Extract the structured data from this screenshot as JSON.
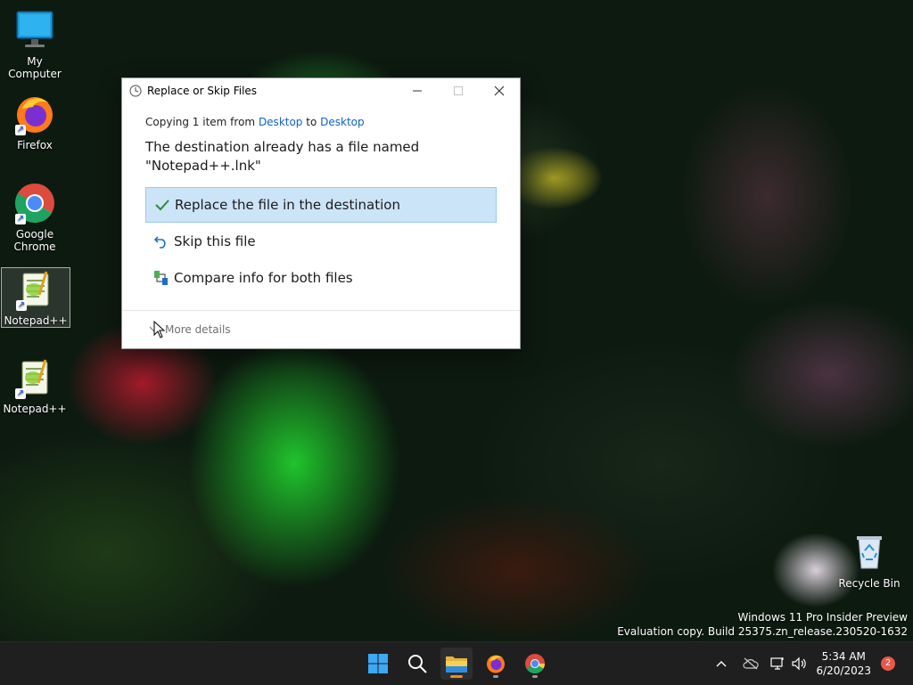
{
  "desktop": {
    "icons": [
      {
        "label": "My Computer"
      },
      {
        "label": "Firefox"
      },
      {
        "label": "Google Chrome"
      },
      {
        "label": "Notepad++"
      },
      {
        "label": "Notepad++"
      },
      {
        "label": "Recycle Bin"
      }
    ],
    "watermark": {
      "line1": "Windows 11 Pro Insider Preview",
      "line2": "Evaluation copy. Build 25375.zn_release.230520-1632"
    }
  },
  "dialog": {
    "title": "Replace or Skip Files",
    "copying_prefix": "Copying 1 item from ",
    "source": "Desktop",
    "copying_mid": " to ",
    "destination": "Desktop",
    "message_line1": "The destination already has a file named",
    "message_line2": "\"Notepad++.lnk\"",
    "options": [
      {
        "label": "Replace the file in the destination",
        "icon": "checkmark-icon",
        "selected": true
      },
      {
        "label": "Skip this file",
        "icon": "undo-arrow-icon",
        "selected": false
      },
      {
        "label": "Compare info for both files",
        "icon": "compare-icon",
        "selected": false
      }
    ],
    "more_details": "More details"
  },
  "taskbar": {
    "apps": [
      "start-icon",
      "search-icon",
      "file-explorer-icon",
      "firefox-icon",
      "chrome-icon"
    ],
    "time": "5:34 AM",
    "date": "6/20/2023",
    "notification_count": "2"
  },
  "colors": {
    "accent_blue": "#0e62c8",
    "selection_bg": "#cce4f7",
    "taskbar_bg": "#1f1f1f",
    "badge_red": "#e8584a"
  }
}
